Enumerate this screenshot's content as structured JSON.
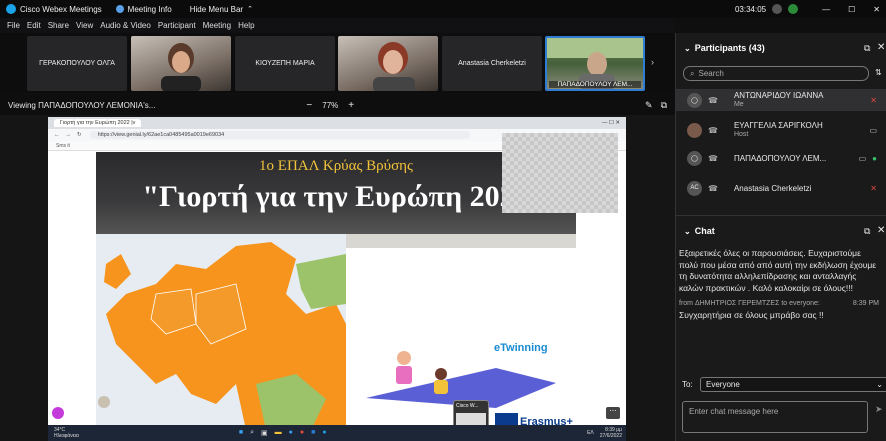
{
  "titlebar": {
    "app_title": "Cisco Webex Meetings",
    "meeting_info": "Meeting Info",
    "hide_menu": "Hide Menu Bar",
    "clock": "03:34:05"
  },
  "menu": [
    "File",
    "Edit",
    "Share",
    "View",
    "Audio & Video",
    "Participant",
    "Meeting",
    "Help"
  ],
  "video_strip": [
    {
      "name": "ΓΕΡΑΚΟΠΟΥΛΟΥ ΟΛΓΑ",
      "video": false
    },
    {
      "name": "",
      "video": true
    },
    {
      "name": "ΚΙΟΥΖΕΠΗ ΜΑΡΙΑ",
      "video": false
    },
    {
      "name": "",
      "video": true
    },
    {
      "name": "Anastasia Cherkeletzi",
      "video": false
    },
    {
      "name": "ΠΑΠΑΔΟΠΟΥΛΟΥ ΛΕΜ...",
      "video": true
    }
  ],
  "viewbar": {
    "viewing": "Viewing ΠΑΠΑΔΟΠΟΥΛΟΥ ΛΕΜΟΝΙΑ's...",
    "zoom": "77%",
    "minus": "−",
    "plus": "+"
  },
  "shared": {
    "tab_title": "Γιορτή για την Ευρώπη 2022 |v",
    "url": "https://view.genial.ly/62ae1ca0485495a0019e69034",
    "bookmark": "Sms it",
    "slide_line1": "1ο ΕΠΑΛ Κρύας Βρύσης",
    "slide_line2": "\"Γιορτή για την Ευρώπη 2022",
    "etwinning": "eTwinning",
    "erasmus": "Erasmus+",
    "mini_window": "Cisco W...",
    "weather_temp": "34°C",
    "weather_desc": "Ηλιοφάνεια",
    "tray_lang": "ΕΛ",
    "tray_time": "8:39 μμ",
    "tray_date": "27/6/2022"
  },
  "participants": {
    "title": "Participants (43)",
    "search_placeholder": "Search",
    "list": [
      {
        "name": "ΑΝΤΩΝΑΡΙΔΟΥ ΙΩΑΝΝΑ",
        "role": "Me",
        "initials": "",
        "mic": "muted"
      },
      {
        "name": "ΕΥΑΓΓΕΛΙΑ ΣΑΡΙΓΚΟΛΗ",
        "role": "Host",
        "initials": "",
        "mic": "video"
      },
      {
        "name": "ΠΑΠΑΔΟΠΟΥΛΟΥ ΛΕΜ...",
        "role": "",
        "initials": "",
        "mic": "active"
      },
      {
        "name": "Anastasia Cherkeletzi",
        "role": "",
        "initials": "AC",
        "mic": "muted"
      }
    ]
  },
  "chat": {
    "title": "Chat",
    "message1": "Εξαιρετικές όλες οι παρουσιάσεις. Ευχαριστούμε πολύ που μέσα από από αυτή την εκδήλωση έχουμε τη δυνατότητα αλληλεπίδρασης και ανταλλαγής καλών πρακτικών . Καλό καλοκαίρι σε όλους!!!",
    "meta_from": "from ΔΗΜΗΤΡΙΟΣ ΓΕΡΕΜΤΖΕΣ to everyone:",
    "meta_time": "8:39 PM",
    "message2": "Συγχαρητήρια σε όλους μπράβο σας !!",
    "to_label": "To:",
    "to_value": "Everyone",
    "input_placeholder": "Enter chat message here"
  },
  "colors": {
    "accent": "#2f7dd3",
    "panel_bg": "#1a1a1b",
    "muted_red": "#e0473c",
    "map_orange": "#f7941d"
  }
}
